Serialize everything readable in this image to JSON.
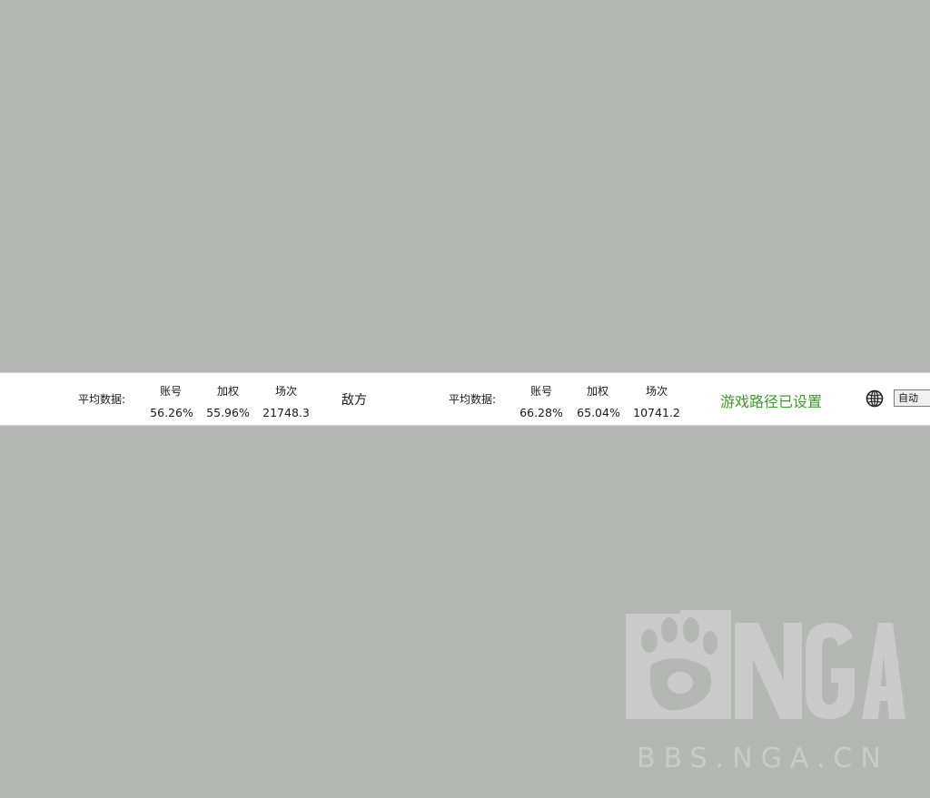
{
  "friendly": {
    "avg_label": "平均数据:",
    "headers": [
      "账号",
      "加权",
      "场次"
    ],
    "values": [
      "56.26%",
      "55.96%",
      "21748.3"
    ]
  },
  "enemy": {
    "side_label": "敌方",
    "avg_label": "平均数据:",
    "headers": [
      "账号",
      "加权",
      "场次"
    ],
    "values": [
      "66.28%",
      "65.04%",
      "10741.2"
    ]
  },
  "status": {
    "text": "游戏路径已设置",
    "color": "#3e9a2a"
  },
  "language": {
    "icon": "globe-icon",
    "selected": "自动"
  },
  "watermark": {
    "logo": "NGA",
    "site": "BBS.NGA.CN"
  }
}
